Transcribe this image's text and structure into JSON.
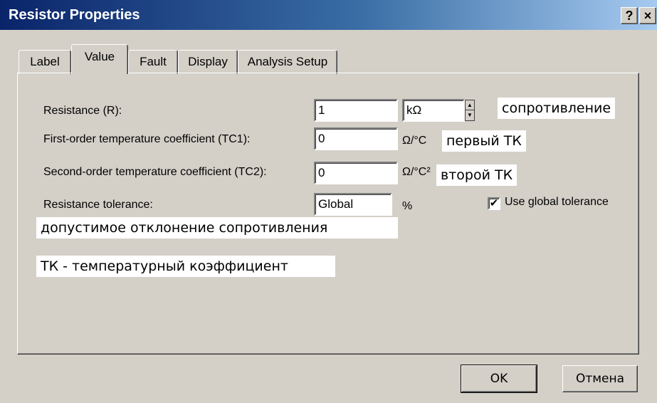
{
  "window": {
    "title": "Resistor Properties",
    "help_button": "?",
    "close_button": "×"
  },
  "tabs": [
    {
      "label": "Label",
      "selected": false
    },
    {
      "label": "Value",
      "selected": true
    },
    {
      "label": "Fault",
      "selected": false
    },
    {
      "label": "Display",
      "selected": false
    },
    {
      "label": "Analysis Setup",
      "selected": false
    }
  ],
  "form": {
    "resistance": {
      "label": "Resistance (R):",
      "value": "1",
      "unit": "kΩ",
      "note": "сопротивление"
    },
    "tc1": {
      "label": "First-order temperature coefficient (TC1):",
      "value": "0",
      "unit": "Ω/°C",
      "note": "первый ТК"
    },
    "tc2": {
      "label": "Second-order temperature coefficient (TC2):",
      "value": "0",
      "unit": "Ω/°C²",
      "note": "второй ТК"
    },
    "tolerance": {
      "label": "Resistance tolerance:",
      "value": "Global",
      "unit": "%",
      "note": "допустимое  отклонение сопротивления"
    },
    "use_global": {
      "label": "Use global tolerance",
      "checked": true,
      "mark": "✔"
    },
    "footnote": "ТК - температурный коэффициент"
  },
  "buttons": {
    "ok": "OK",
    "cancel": "Отмена"
  }
}
